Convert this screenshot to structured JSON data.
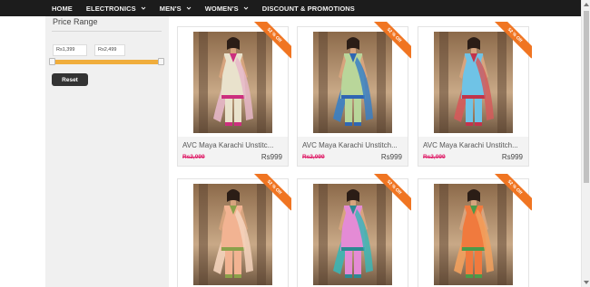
{
  "nav": {
    "items": [
      {
        "label": "HOME",
        "dropdown": false
      },
      {
        "label": "ELECTRONICS",
        "dropdown": true
      },
      {
        "label": "MEN'S",
        "dropdown": true
      },
      {
        "label": "WOMEN'S",
        "dropdown": true
      },
      {
        "label": "DISCOUNT & PROMOTIONS",
        "dropdown": false
      }
    ]
  },
  "filter": {
    "title": "Price Range",
    "min_price": "Rs1,399",
    "max_price": "Rs2,499",
    "reset_label": "Reset"
  },
  "products": [
    {
      "name": "AVC Maya Karachi Unstitc...",
      "old_price": "Rs2,099",
      "price": "Rs999",
      "discount": "52 % Off",
      "kameez": "#e9e2cc",
      "accent": "#cc2f7e",
      "dupatta": "#e6b7c8"
    },
    {
      "name": "AVC Maya Karachi Unstitch...",
      "old_price": "Rs2,099",
      "price": "Rs999",
      "discount": "52 % Off",
      "kameez": "#b9d69a",
      "accent": "#2f66b3",
      "dupatta": "#3a7fc4"
    },
    {
      "name": "AVC Maya Karachi Unstitch...",
      "old_price": "Rs2,099",
      "price": "Rs999",
      "discount": "52 % Off",
      "kameez": "#6fc3e6",
      "accent": "#c2344b",
      "dupatta": "#d45a5a"
    },
    {
      "name": "",
      "old_price": "",
      "price": "",
      "discount": "52 % Off",
      "kameez": "#f2b392",
      "accent": "#8aa14a",
      "dupatta": "#f4d4bd"
    },
    {
      "name": "",
      "old_price": "",
      "price": "",
      "discount": "52 % Off",
      "kameez": "#e48bd5",
      "accent": "#2c8a92",
      "dupatta": "#3bb5b5"
    },
    {
      "name": "",
      "old_price": "",
      "price": "",
      "discount": "52 % Off",
      "kameez": "#f07a3e",
      "accent": "#4a9b4a",
      "dupatta": "#f2a15e"
    }
  ],
  "colors": {
    "nav_bg": "#1c1c1c",
    "sidebar_bg": "#f0f0f0",
    "slider": "#f0ad3c",
    "ribbon": "#f07522",
    "old_price": "#e0206a"
  }
}
